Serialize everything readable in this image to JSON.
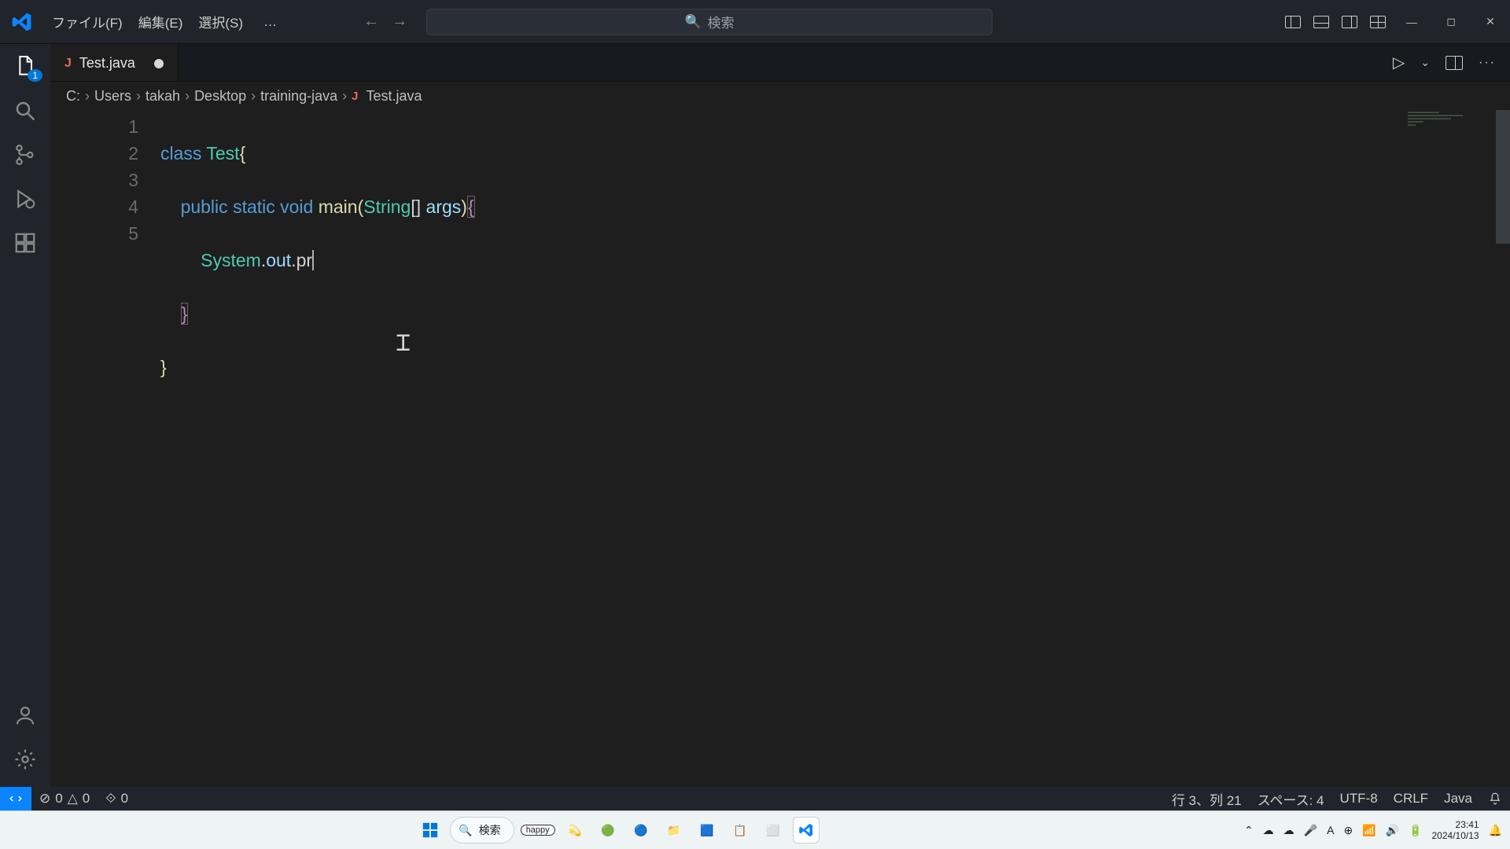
{
  "titlebar": {
    "menus": {
      "file": "ファイル(F)",
      "edit": "編集(E)",
      "select": "選択(S)",
      "more": "…"
    },
    "search_placeholder": "検索"
  },
  "activitybar": {
    "explorer_badge": "1"
  },
  "tab": {
    "filename": "Test.java"
  },
  "breadcrumb": {
    "parts": [
      "C:",
      "Users",
      "takah",
      "Desktop",
      "training-java"
    ],
    "file": "Test.java"
  },
  "code": {
    "l1": {
      "kw": "class",
      "type": "Test",
      "brace": "{"
    },
    "l2": {
      "indent": "    ",
      "kw1": "public",
      "kw2": "static",
      "kw3": "void",
      "fn": "main",
      "lp": "(",
      "type": "String",
      "brk": "[]",
      "sp": " ",
      "arg": "args",
      "rp": ")",
      "lb": "{"
    },
    "l3": {
      "indent": "        ",
      "a": "System",
      "d1": ".",
      "b": "out",
      "d2": ".",
      "c": "pr"
    },
    "l4": {
      "indent": "    ",
      "rb": "}"
    },
    "l5": {
      "rb": "}"
    }
  },
  "line_numbers": [
    "1",
    "2",
    "3",
    "4",
    "5"
  ],
  "statusbar": {
    "errors": "0",
    "warnings": "0",
    "ports": "0",
    "position": "行 3、列 21",
    "spaces": "スペース: 4",
    "encoding": "UTF-8",
    "eol": "CRLF",
    "lang": "Java"
  },
  "taskbar": {
    "search_placeholder": "検索",
    "ime_badge": "happy",
    "ime_letter": "A",
    "time": "23:41",
    "date": "2024/10/13"
  },
  "icons": {
    "search": "⌕",
    "play": "▷",
    "chev_down": "⌄",
    "chev_right": "›",
    "more_h": "···",
    "bell": "♪",
    "error_circle": "⊘",
    "warn_tri": "△",
    "antenna": "⟐"
  }
}
